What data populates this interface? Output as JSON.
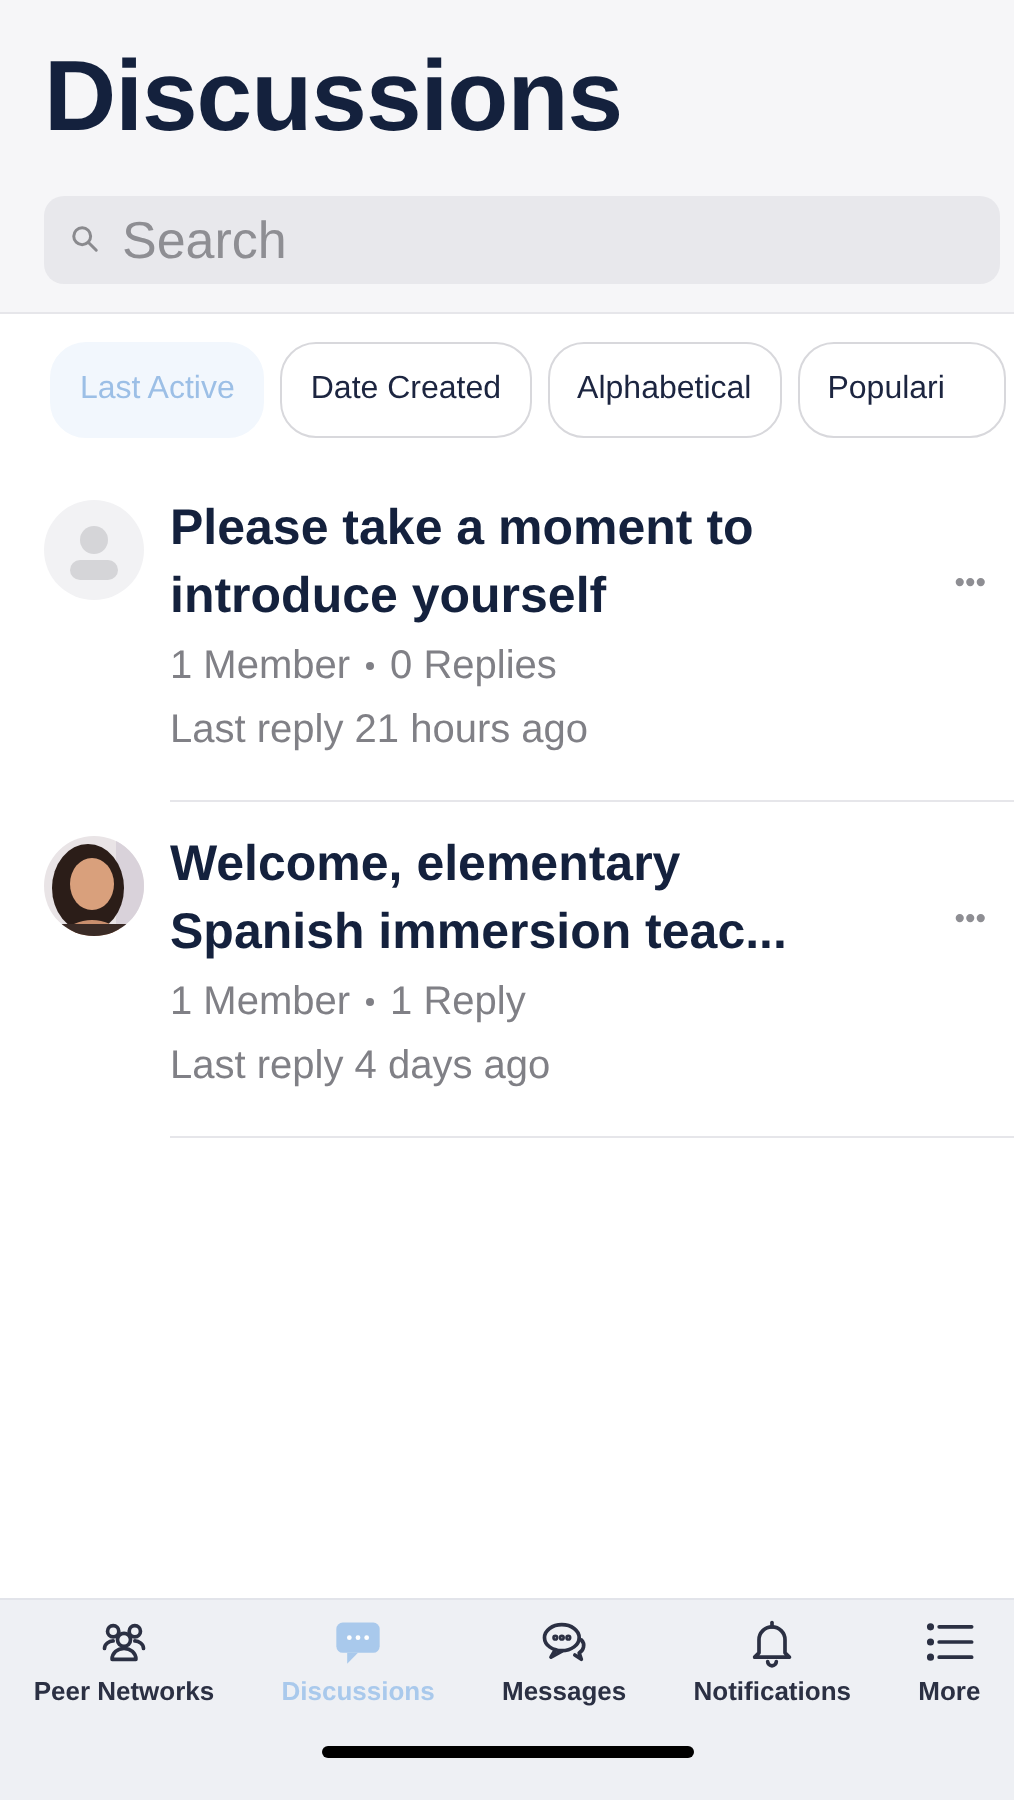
{
  "header": {
    "title": "Discussions"
  },
  "search": {
    "placeholder": "Search"
  },
  "sort_chips": [
    {
      "label": "Last Active",
      "selected": true
    },
    {
      "label": "Date Created",
      "selected": false
    },
    {
      "label": "Alphabetical",
      "selected": false
    },
    {
      "label": "Populari",
      "selected": false
    }
  ],
  "discussions": [
    {
      "kind": "placeholder",
      "title": "Please take a moment to introduce yourself",
      "members": "1 Member",
      "replies": "0 Replies",
      "last_reply": "Last reply 21 hours ago",
      "more": "•••"
    },
    {
      "kind": "picture",
      "title": "Welcome, elementary Spanish immersion teac...",
      "members": "1 Member",
      "replies": "1 Reply",
      "last_reply": "Last reply 4 days ago",
      "more": "•••"
    }
  ],
  "tab_bar": [
    {
      "label": "Peer Networks",
      "selected": false
    },
    {
      "label": "Discussions",
      "selected": true
    },
    {
      "label": "Messages",
      "selected": false
    },
    {
      "label": "Notifications",
      "selected": false
    },
    {
      "label": "More",
      "selected": false
    }
  ]
}
